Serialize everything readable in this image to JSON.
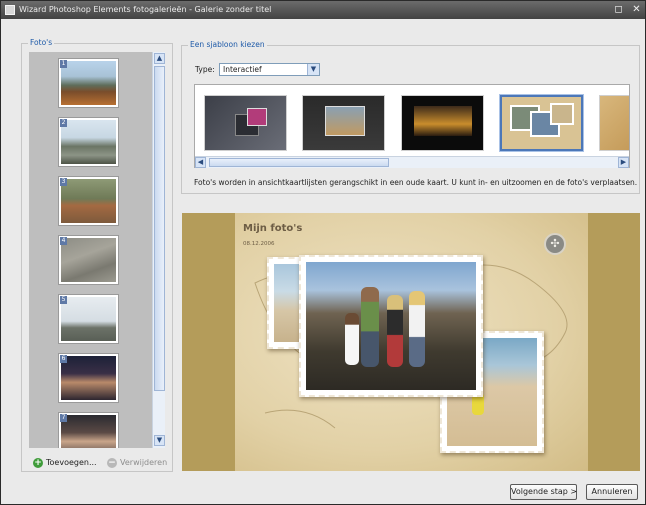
{
  "window": {
    "title": "Wizard Photoshop Elements fotogalerieën - Galerie zonder titel",
    "restore_glyph": "◻",
    "close_glyph": "✕"
  },
  "photos_panel": {
    "label": "Foto's",
    "thumbnails": [
      {
        "number": "1"
      },
      {
        "number": "2"
      },
      {
        "number": "3"
      },
      {
        "number": "4"
      },
      {
        "number": "5"
      },
      {
        "number": "6"
      },
      {
        "number": "7"
      }
    ],
    "add_label": "Toevoegen...",
    "remove_label": "Verwijderen"
  },
  "template_panel": {
    "label": "Een sjabloon kiezen",
    "type_label": "Type:",
    "type_value": "Interactief",
    "description": "Foto's worden in ansichtkaartlijsten gerangschikt in een oude kaart. U kunt in- en uitzoomen en de foto's verplaatsen.",
    "selected_index": 3
  },
  "preview": {
    "title": "Mijn foto's",
    "date": "08.12.2006"
  },
  "buttons": {
    "next_label": "Volgende stap >",
    "cancel_label": "Annuleren"
  },
  "colors": {
    "accent": "#1e5aa8",
    "preview_background": "#b49c5a"
  }
}
